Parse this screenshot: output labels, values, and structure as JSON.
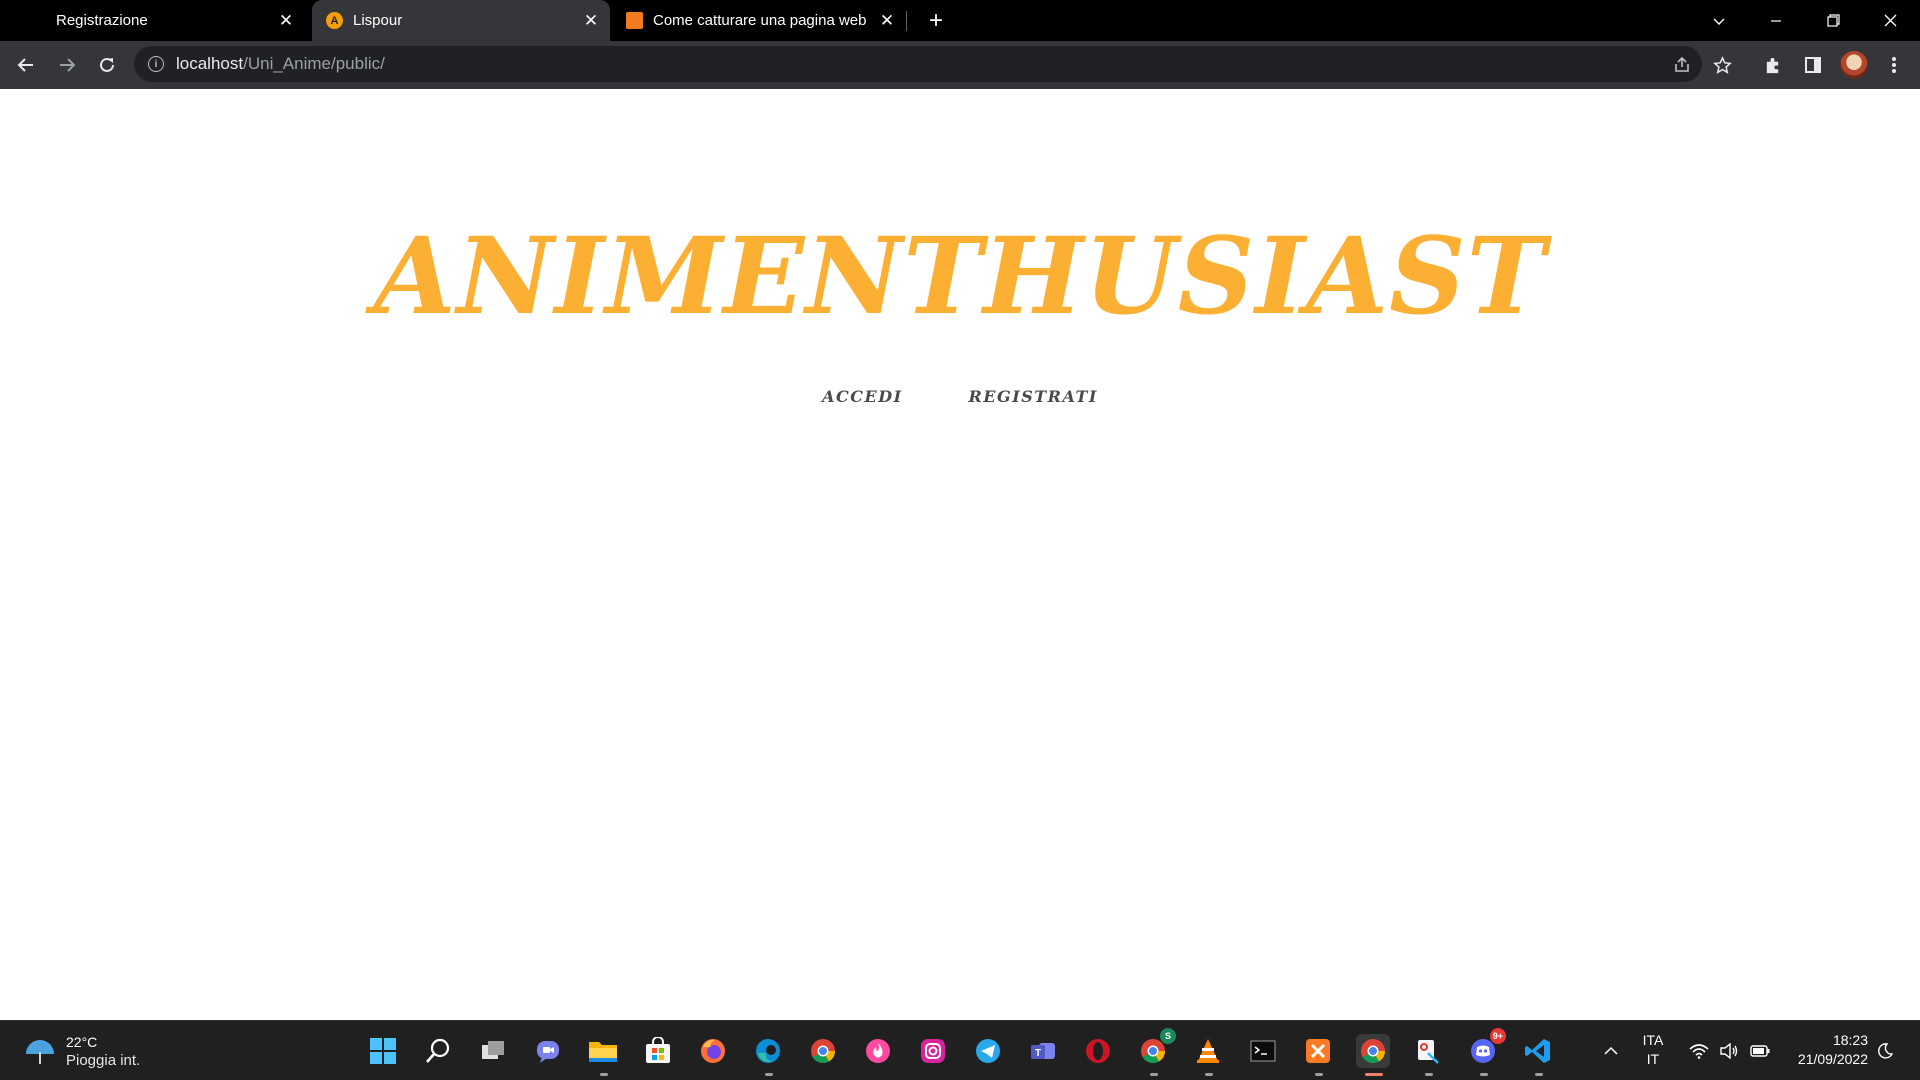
{
  "browser": {
    "tabs": [
      {
        "title": "Registrazione",
        "active": false
      },
      {
        "title": "Lispour",
        "favicon_letter": "A",
        "active": true
      },
      {
        "title": "Come catturare una pagina web",
        "active": false
      }
    ],
    "address": {
      "host": "localhost",
      "path": "/Uni_Anime/public/"
    }
  },
  "page": {
    "brand_title": "ANIMENTHUSIAST",
    "nav": {
      "login": "ACCEDI",
      "register": "REGISTRATI"
    }
  },
  "taskbar": {
    "weather": {
      "temp": "22°C",
      "condition": "Pioggia int."
    },
    "tray": {
      "lang_top": "ITA",
      "lang_bottom": "IT",
      "time": "18:23",
      "date": "21/09/2022"
    },
    "badges": {
      "chrome_profile": "S",
      "discord": "9+"
    }
  },
  "colors": {
    "brand": "#fbb034",
    "nav_text": "#4a4a4a",
    "tab_strip": "#000000",
    "toolbar": "#35363a",
    "taskbar": "#202020"
  }
}
